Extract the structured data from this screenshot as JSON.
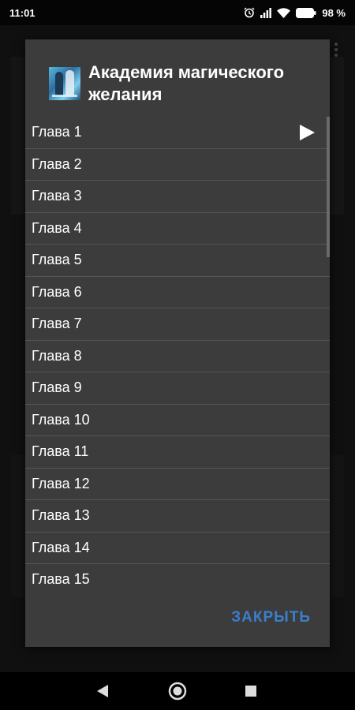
{
  "status_bar": {
    "time": "11:01",
    "battery": "98 %",
    "icons": [
      "alarm-icon",
      "signal-icon",
      "wifi-icon",
      "battery-icon"
    ]
  },
  "dialog": {
    "title": "Академия магического желания",
    "cover_icon": "book-cover-image",
    "chapters": [
      {
        "label": "Глава 1",
        "playing": true
      },
      {
        "label": "Глава 2"
      },
      {
        "label": "Глава 3"
      },
      {
        "label": "Глава 4"
      },
      {
        "label": "Глава 5"
      },
      {
        "label": "Глава 6"
      },
      {
        "label": "Глава 7"
      },
      {
        "label": "Глава 8"
      },
      {
        "label": "Глава 9"
      },
      {
        "label": "Глава 10"
      },
      {
        "label": "Глава 11"
      },
      {
        "label": "Глава 12"
      },
      {
        "label": "Глава 13"
      },
      {
        "label": "Глава 14"
      },
      {
        "label": "Глава 15"
      }
    ],
    "close_label": "ЗАКРЫТЬ"
  },
  "colors": {
    "dialog_bg": "#3c3c3c",
    "accent": "#3b7ecb",
    "divider": "#555555"
  },
  "nav_bar": {
    "icons": [
      "back-icon",
      "home-icon",
      "recents-icon"
    ]
  }
}
